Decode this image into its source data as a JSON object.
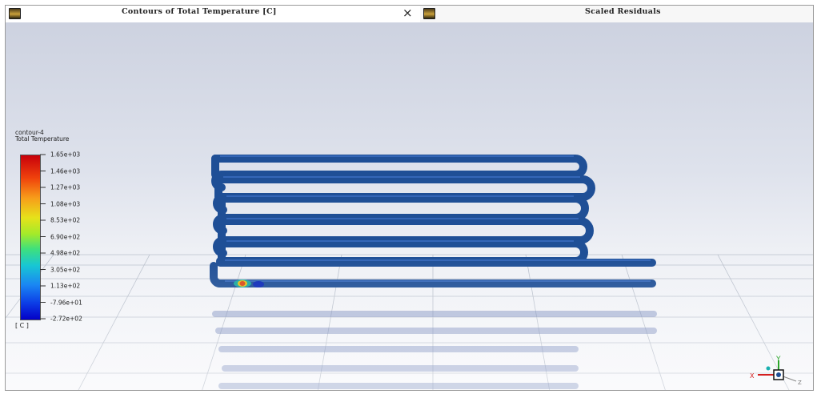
{
  "tabs": [
    {
      "title": "Contours of Total Temperature [C]",
      "close": "×"
    },
    {
      "title": "Scaled Residuals"
    }
  ],
  "legend": {
    "name": "contour-4",
    "variable": "Total Temperature",
    "unit": "[ C ]",
    "labels": [
      "1.65e+03",
      "1.46e+03",
      "1.27e+03",
      "1.08e+03",
      "8.53e+02",
      "6.90e+02",
      "4.98e+02",
      "3.05e+02",
      "1.13e+02",
      "-7.96e+01",
      "-2.72e+02"
    ],
    "colormap": [
      "#c8000b",
      "#f0430c",
      "#f79d1a",
      "#e6e21a",
      "#a3ea2a",
      "#3fe07c",
      "#18c7d3",
      "#1a86f3",
      "#0c3de6",
      "#0400c7"
    ]
  },
  "model": {
    "tube_color": "#1f4f96",
    "hot_spot_color": "#d94a1a"
  },
  "axes": {
    "x": "X",
    "y": "Y",
    "z": "Z"
  }
}
